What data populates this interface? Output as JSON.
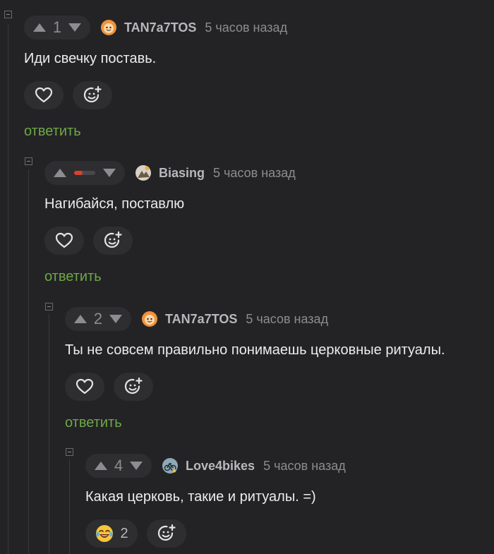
{
  "comments": [
    {
      "score": "1",
      "author": "TAN7a7TOS",
      "time": "5 часов назад",
      "text": "Иди свечку поставь.",
      "reply_label": "ответить"
    },
    {
      "score": "",
      "score_state": "negative",
      "author": "Biasing",
      "time": "5 часов назад",
      "text": "Нагибайся, поставлю",
      "reply_label": "ответить"
    },
    {
      "score": "2",
      "author": "TAN7a7TOS",
      "time": "5 часов назад",
      "text": "Ты не совсем правильно понимаешь церковные ритуалы.",
      "reply_label": "ответить"
    },
    {
      "score": "4",
      "author": "Love4bikes",
      "time": "5 часов назад",
      "text": "Какая церковь, такие и ритуалы. =)",
      "reaction": {
        "icon": "laughing-tears-emoji-icon",
        "count": "2"
      }
    }
  ],
  "colors": {
    "background": "#232325",
    "reply_link": "#6ea748",
    "pill": "#2e2e31",
    "muted_text": "#8d8d91",
    "negative": "#d9412f"
  }
}
